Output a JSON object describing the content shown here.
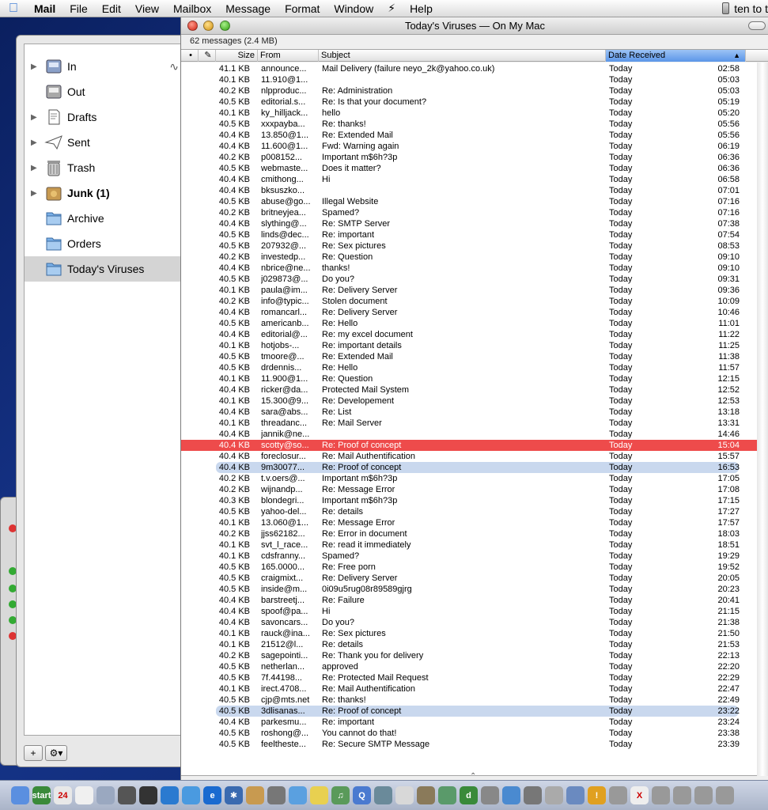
{
  "menubar": {
    "app_name": "Mail",
    "items": [
      "File",
      "Edit",
      "View",
      "Mailbox",
      "Message",
      "Format",
      "Window",
      "Script",
      "Help"
    ],
    "script_glyph": "⚡",
    "right_text": "ten to t"
  },
  "window": {
    "title": "Today's Viruses — On My Mac",
    "status": "62 messages (2.4 MB)"
  },
  "columns": {
    "size": "Size",
    "from": "From",
    "subject": "Subject",
    "date": "Date Received"
  },
  "sidebar": {
    "mailboxes": [
      {
        "label": "In",
        "icon": "inbox-icon",
        "expandable": true,
        "bold": false,
        "selected": false
      },
      {
        "label": "Out",
        "icon": "outbox-icon",
        "expandable": false,
        "bold": false,
        "selected": false
      },
      {
        "label": "Drafts",
        "icon": "drafts-icon",
        "expandable": true,
        "bold": false,
        "selected": false
      },
      {
        "label": "Sent",
        "icon": "sent-icon",
        "expandable": true,
        "bold": false,
        "selected": false
      },
      {
        "label": "Trash",
        "icon": "trash-icon",
        "expandable": true,
        "bold": false,
        "selected": false
      },
      {
        "label": "Junk (1)",
        "icon": "junk-icon",
        "expandable": true,
        "bold": true,
        "selected": false
      },
      {
        "label": "Archive",
        "icon": "folder-icon",
        "expandable": false,
        "bold": false,
        "selected": false
      },
      {
        "label": "Orders",
        "icon": "folder-icon",
        "expandable": false,
        "bold": false,
        "selected": false
      },
      {
        "label": "Today's Viruses",
        "icon": "folder-icon",
        "expandable": false,
        "bold": false,
        "selected": true
      }
    ],
    "add_button": "+",
    "action_button": "⚙▾"
  },
  "colors": {
    "selection_red": "#ee4b4b",
    "highlight_blue": "#c9d8ee",
    "sort_header": "#5b95e8"
  },
  "messages": [
    {
      "size": "41.1 KB",
      "from": "announce...",
      "subject": "Mail Delivery (failure neyo_2k@yahoo.co.uk)",
      "date": "Today",
      "time": "02:58"
    },
    {
      "size": "40.1 KB",
      "from": "11.910@1...",
      "subject": "",
      "date": "Today",
      "time": "05:03"
    },
    {
      "size": "40.2 KB",
      "from": "nlpproduc...",
      "subject": "Re: Administration",
      "date": "Today",
      "time": "05:03"
    },
    {
      "size": "40.5 KB",
      "from": "editorial.s...",
      "subject": "Re: Is that your document?",
      "date": "Today",
      "time": "05:19"
    },
    {
      "size": "40.1 KB",
      "from": "ky_hilljack...",
      "subject": "hello",
      "date": "Today",
      "time": "05:20"
    },
    {
      "size": "40.5 KB",
      "from": "xxxpayba...",
      "subject": "Re: thanks!",
      "date": "Today",
      "time": "05:56"
    },
    {
      "size": "40.4 KB",
      "from": "13.850@1...",
      "subject": "Re: Extended Mail",
      "date": "Today",
      "time": "05:56"
    },
    {
      "size": "40.4 KB",
      "from": "11.600@1...",
      "subject": "Fwd: Warning again",
      "date": "Today",
      "time": "06:19"
    },
    {
      "size": "40.2 KB",
      "from": "p008152...",
      "subject": "Important m$6h?3p",
      "date": "Today",
      "time": "06:36"
    },
    {
      "size": "40.5 KB",
      "from": "webmaste...",
      "subject": "Does it matter?",
      "date": "Today",
      "time": "06:36"
    },
    {
      "size": "40.4 KB",
      "from": "cmithong...",
      "subject": "Hi",
      "date": "Today",
      "time": "06:58"
    },
    {
      "size": "40.4 KB",
      "from": "bksuszko...",
      "subject": "",
      "date": "Today",
      "time": "07:01"
    },
    {
      "size": "40.5 KB",
      "from": "abuse@go...",
      "subject": "Illegal Website",
      "date": "Today",
      "time": "07:16"
    },
    {
      "size": "40.2 KB",
      "from": "britneyjea...",
      "subject": "Spamed?",
      "date": "Today",
      "time": "07:16"
    },
    {
      "size": "40.4 KB",
      "from": "slything@...",
      "subject": "Re: SMTP Server",
      "date": "Today",
      "time": "07:38"
    },
    {
      "size": "40.5 KB",
      "from": "linds@dec...",
      "subject": "Re: important",
      "date": "Today",
      "time": "07:54"
    },
    {
      "size": "40.5 KB",
      "from": "207932@...",
      "subject": "Re: Sex pictures",
      "date": "Today",
      "time": "08:53"
    },
    {
      "size": "40.2 KB",
      "from": "investedp...",
      "subject": "Re: Question",
      "date": "Today",
      "time": "09:10"
    },
    {
      "size": "40.4 KB",
      "from": "nbrice@ne...",
      "subject": "thanks!",
      "date": "Today",
      "time": "09:10"
    },
    {
      "size": "40.5 KB",
      "from": "j029873@...",
      "subject": "Do you?",
      "date": "Today",
      "time": "09:31"
    },
    {
      "size": "40.1 KB",
      "from": "paula@im...",
      "subject": "Re: Delivery Server",
      "date": "Today",
      "time": "09:36"
    },
    {
      "size": "40.2 KB",
      "from": "info@typic...",
      "subject": "Stolen document",
      "date": "Today",
      "time": "10:09"
    },
    {
      "size": "40.4 KB",
      "from": "romancarl...",
      "subject": "Re: Delivery Server",
      "date": "Today",
      "time": "10:46"
    },
    {
      "size": "40.5 KB",
      "from": "americanb...",
      "subject": "Re: Hello",
      "date": "Today",
      "time": "11:01"
    },
    {
      "size": "40.4 KB",
      "from": "editorial@...",
      "subject": "Re: my excel document",
      "date": "Today",
      "time": "11:22"
    },
    {
      "size": "40.1 KB",
      "from": "hotjobs-...",
      "subject": "Re: important details",
      "date": "Today",
      "time": "11:25"
    },
    {
      "size": "40.5 KB",
      "from": "tmoore@...",
      "subject": "Re: Extended Mail",
      "date": "Today",
      "time": "11:38"
    },
    {
      "size": "40.5 KB",
      "from": "drdennis...",
      "subject": "Re: Hello",
      "date": "Today",
      "time": "11:57"
    },
    {
      "size": "40.1 KB",
      "from": "11.900@1...",
      "subject": "Re: Question",
      "date": "Today",
      "time": "12:15"
    },
    {
      "size": "40.4 KB",
      "from": "ricker@da...",
      "subject": "Protected Mail System",
      "date": "Today",
      "time": "12:52"
    },
    {
      "size": "40.1 KB",
      "from": "15.300@9...",
      "subject": "Re: Developement",
      "date": "Today",
      "time": "12:53"
    },
    {
      "size": "40.4 KB",
      "from": "sara@abs...",
      "subject": "Re: List",
      "date": "Today",
      "time": "13:18"
    },
    {
      "size": "40.1 KB",
      "from": "threadanc...",
      "subject": "Re: Mail Server",
      "date": "Today",
      "time": "13:31"
    },
    {
      "size": "40.4 KB",
      "from": "jannik@ne...",
      "subject": "",
      "date": "Today",
      "time": "14:46"
    },
    {
      "size": "40.4 KB",
      "from": "scotty@so...",
      "subject": "Re: Proof of concept",
      "date": "Today",
      "time": "15:04",
      "highlight": "red"
    },
    {
      "size": "40.4 KB",
      "from": "foreclosur...",
      "subject": "Re: Mail Authentification",
      "date": "Today",
      "time": "15:57"
    },
    {
      "size": "40.4 KB",
      "from": "9m30077...",
      "subject": "Re: Proof of concept",
      "date": "Today",
      "time": "16:53",
      "highlight": "blue"
    },
    {
      "size": "40.2 KB",
      "from": "t.v.oers@...",
      "subject": "Important m$6h?3p",
      "date": "Today",
      "time": "17:05"
    },
    {
      "size": "40.2 KB",
      "from": "wijnandp...",
      "subject": "Re: Message Error",
      "date": "Today",
      "time": "17:08"
    },
    {
      "size": "40.3 KB",
      "from": "blondegri...",
      "subject": "Important m$6h?3p",
      "date": "Today",
      "time": "17:15"
    },
    {
      "size": "40.5 KB",
      "from": "yahoo-del...",
      "subject": "Re: details",
      "date": "Today",
      "time": "17:27"
    },
    {
      "size": "40.1 KB",
      "from": "13.060@1...",
      "subject": "Re: Message Error",
      "date": "Today",
      "time": "17:57"
    },
    {
      "size": "40.2 KB",
      "from": "jjss62182...",
      "subject": "Re: Error in document",
      "date": "Today",
      "time": "18:03"
    },
    {
      "size": "40.1 KB",
      "from": "svt_l_race...",
      "subject": "Re: read it immediately",
      "date": "Today",
      "time": "18:51"
    },
    {
      "size": "40.1 KB",
      "from": "cdsfranny...",
      "subject": "Spamed?",
      "date": "Today",
      "time": "19:29"
    },
    {
      "size": "40.5 KB",
      "from": "165.0000...",
      "subject": "Re: Free porn",
      "date": "Today",
      "time": "19:52"
    },
    {
      "size": "40.5 KB",
      "from": "craigmixt...",
      "subject": "Re: Delivery Server",
      "date": "Today",
      "time": "20:05"
    },
    {
      "size": "40.5 KB",
      "from": "inside@m...",
      "subject": "0i09u5rug08r89589gjrg",
      "date": "Today",
      "time": "20:23"
    },
    {
      "size": "40.4 KB",
      "from": "barstreetj...",
      "subject": "Re: Failure",
      "date": "Today",
      "time": "20:41"
    },
    {
      "size": "40.4 KB",
      "from": "spoof@pa...",
      "subject": "Hi",
      "date": "Today",
      "time": "21:15"
    },
    {
      "size": "40.4 KB",
      "from": "savoncars...",
      "subject": "Do you?",
      "date": "Today",
      "time": "21:38"
    },
    {
      "size": "40.1 KB",
      "from": "rauck@ina...",
      "subject": "Re: Sex pictures",
      "date": "Today",
      "time": "21:50"
    },
    {
      "size": "40.1 KB",
      "from": "21512@l...",
      "subject": "Re: details",
      "date": "Today",
      "time": "21:53"
    },
    {
      "size": "40.2 KB",
      "from": "sagepointi...",
      "subject": "Re: Thank you for delivery",
      "date": "Today",
      "time": "22:13"
    },
    {
      "size": "40.5 KB",
      "from": "netherlan...",
      "subject": "approved",
      "date": "Today",
      "time": "22:20"
    },
    {
      "size": "40.5 KB",
      "from": "7f.44198...",
      "subject": "Re: Protected Mail Request",
      "date": "Today",
      "time": "22:29"
    },
    {
      "size": "40.1 KB",
      "from": "irect.4708...",
      "subject": "Re: Mail Authentification",
      "date": "Today",
      "time": "22:47"
    },
    {
      "size": "40.5 KB",
      "from": "cjp@mts.net",
      "subject": "Re: thanks!",
      "date": "Today",
      "time": "22:49"
    },
    {
      "size": "40.5 KB",
      "from": "3dlisanas...",
      "subject": "Re: Proof of concept",
      "date": "Today",
      "time": "23:22",
      "highlight": "blue"
    },
    {
      "size": "40.4 KB",
      "from": "parkesmu...",
      "subject": "Re: important",
      "date": "Today",
      "time": "23:24"
    },
    {
      "size": "40.5 KB",
      "from": "roshong@...",
      "subject": "You cannot do that!",
      "date": "Today",
      "time": "23:38"
    },
    {
      "size": "40.5 KB",
      "from": "feeltheste...",
      "subject": "Re: Secure SMTP Message",
      "date": "Today",
      "time": "23:39"
    }
  ],
  "dock": [
    {
      "icon": "finder-icon",
      "color": "#5a8fe0",
      "text": ""
    },
    {
      "icon": "start-icon",
      "color": "#3a8a3a",
      "text": "start"
    },
    {
      "icon": "ical-icon",
      "color": "#e8e8e8",
      "text": "24"
    },
    {
      "icon": "clock-icon",
      "color": "#f0f0f0",
      "text": ""
    },
    {
      "icon": "mail-icon",
      "color": "#9aa8c0",
      "text": ""
    },
    {
      "icon": "magnifier-icon",
      "color": "#555",
      "text": ""
    },
    {
      "icon": "preview-icon",
      "color": "#333",
      "text": ""
    },
    {
      "icon": "globe-icon",
      "color": "#2a7ad0",
      "text": ""
    },
    {
      "icon": "safari-icon",
      "color": "#4a9ae0",
      "text": ""
    },
    {
      "icon": "ie-icon",
      "color": "#1a6ad0",
      "text": "e"
    },
    {
      "icon": "bluetooth-icon",
      "color": "#3a6ab0",
      "text": "✱"
    },
    {
      "icon": "addressbook-icon",
      "color": "#c89a50",
      "text": ""
    },
    {
      "icon": "sync-icon",
      "color": "#777",
      "text": ""
    },
    {
      "icon": "ichat-icon",
      "color": "#5aa0e0",
      "text": ""
    },
    {
      "icon": "stickies-icon",
      "color": "#e8d050",
      "text": ""
    },
    {
      "icon": "itunes-icon",
      "color": "#5a9a5a",
      "text": "♫"
    },
    {
      "icon": "quicktime-icon",
      "color": "#4a7ad0",
      "text": "Q"
    },
    {
      "icon": "sherlock-icon",
      "color": "#6a8a9a",
      "text": ""
    },
    {
      "icon": "textedit-icon",
      "color": "#d8d8d8",
      "text": ""
    },
    {
      "icon": "gimp-icon",
      "color": "#8a7a5a",
      "text": ""
    },
    {
      "icon": "utility-icon",
      "color": "#5a9a6a",
      "text": ""
    },
    {
      "icon": "dreamweaver-icon",
      "color": "#3a8a3a",
      "text": "d"
    },
    {
      "icon": "camera-icon",
      "color": "#888",
      "text": ""
    },
    {
      "icon": "network-icon",
      "color": "#4a8ad0",
      "text": ""
    },
    {
      "icon": "system-prefs-icon",
      "color": "#777",
      "text": ""
    },
    {
      "icon": "docs-icon",
      "color": "#aaa",
      "text": ""
    },
    {
      "icon": "windows-icon",
      "color": "#6a8ac0",
      "text": ""
    },
    {
      "icon": "warning-icon",
      "color": "#e0a020",
      "text": "!"
    },
    {
      "icon": "apple-icon",
      "color": "#999",
      "text": ""
    },
    {
      "icon": "x11-icon",
      "color": "#eee",
      "text": "X"
    },
    {
      "icon": "server-icon",
      "color": "#999",
      "text": ""
    },
    {
      "icon": "server-icon",
      "color": "#999",
      "text": ""
    },
    {
      "icon": "server-icon",
      "color": "#999",
      "text": ""
    },
    {
      "icon": "server-icon",
      "color": "#999",
      "text": ""
    }
  ]
}
